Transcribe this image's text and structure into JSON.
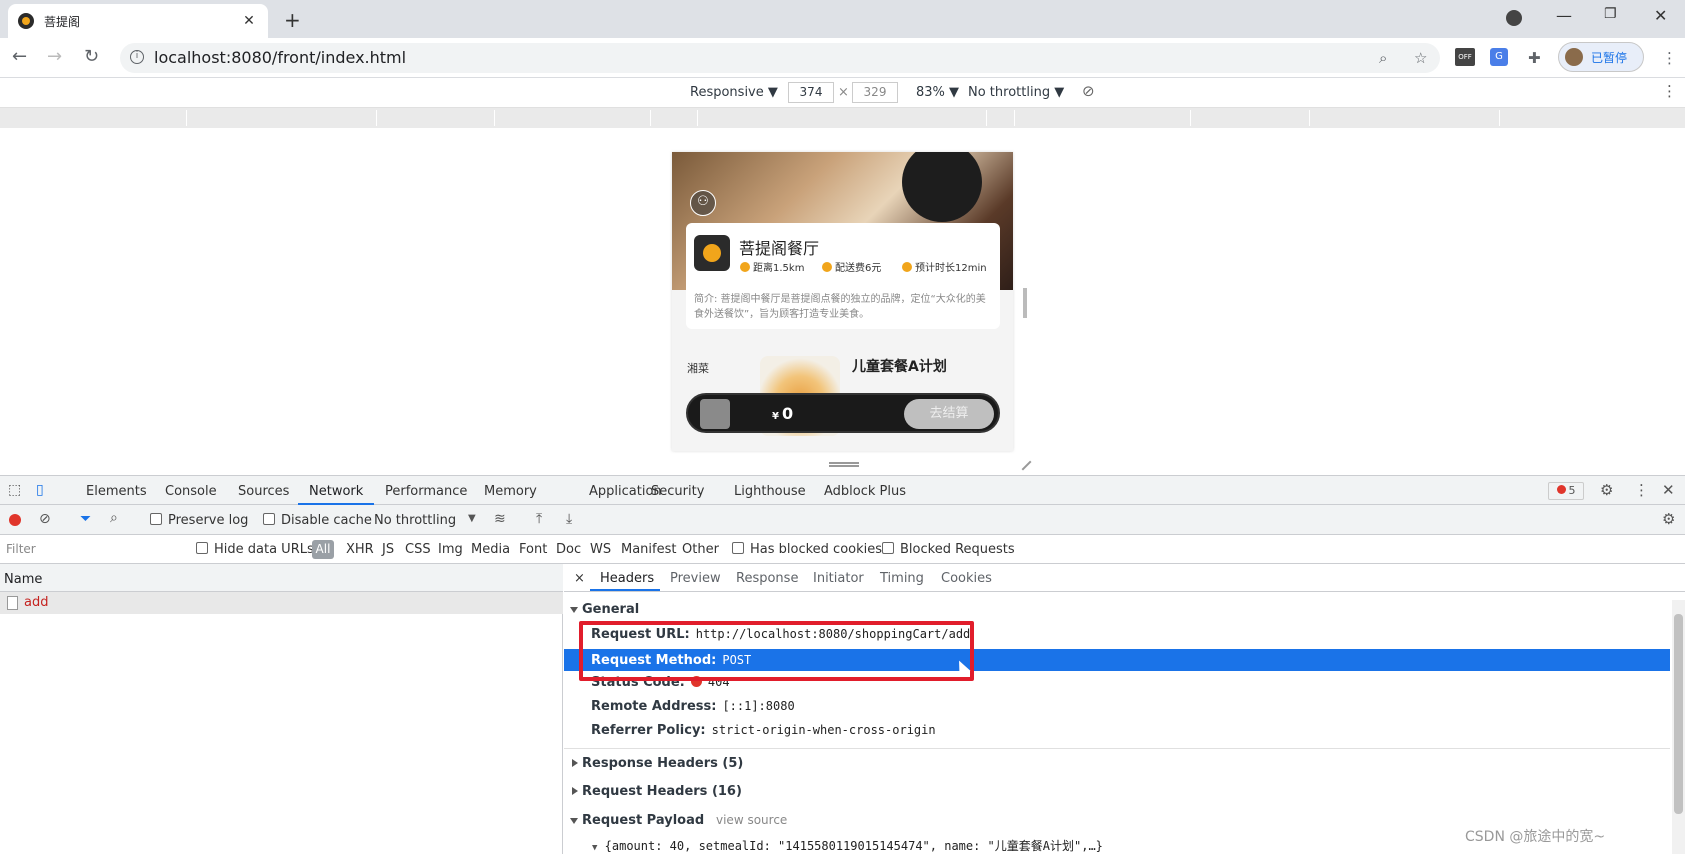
{
  "browser": {
    "tab_title": "菩提阁",
    "tab_close": "✕",
    "new_tab": "+",
    "url": "localhost:8080/front/index.html",
    "profile_label": "已暂停",
    "ext_off_label": "OFF",
    "ext_translate_label": "G"
  },
  "device_toolbar": {
    "device": "Responsive ▼",
    "width": "374",
    "times": "×",
    "height": "329",
    "zoom": "83% ▼",
    "throttling": "No throttling ▼"
  },
  "phone": {
    "restaurant_name": "菩提阁餐厅",
    "distance": "距离1.5km",
    "delivery_fee": "配送费6元",
    "eta": "预计时长12min",
    "intro": "简介: 菩提阁中餐厅是菩提阁点餐的独立的品牌，定位“大众化的美食外送餐饮”，旨为顾客打造专业美食。",
    "category": "湘菜",
    "dish_name": "儿童套餐A计划",
    "currency": "¥",
    "total": "0",
    "checkout": "去结算"
  },
  "devtools": {
    "tabs": [
      "Elements",
      "Console",
      "Sources",
      "Network",
      "Performance",
      "Memory",
      "Application",
      "Security",
      "Lighthouse",
      "Adblock Plus"
    ],
    "error_count": "5",
    "network_toolbar": {
      "preserve_log": "Preserve log",
      "disable_cache": "Disable cache",
      "throttling": "No throttling"
    },
    "filter_bar": {
      "placeholder": "Filter",
      "hide_data_urls": "Hide data URLs",
      "types": [
        "All",
        "XHR",
        "JS",
        "CSS",
        "Img",
        "Media",
        "Font",
        "Doc",
        "WS",
        "Manifest",
        "Other"
      ],
      "has_blocked_cookies": "Has blocked cookies",
      "blocked_requests": "Blocked Requests"
    },
    "list": {
      "header": "Name",
      "rows": [
        "add"
      ]
    },
    "detail_tabs": [
      "Headers",
      "Preview",
      "Response",
      "Initiator",
      "Timing",
      "Cookies"
    ],
    "detail_close": "×",
    "general": {
      "title": "General",
      "request_url_label": "Request URL:",
      "request_url": "http://localhost:8080/shoppingCart/add",
      "request_method_label": "Request Method:",
      "request_method": "POST",
      "status_code_label": "Status Code:",
      "status_code": "404",
      "remote_address_label": "Remote Address:",
      "remote_address": "[::1]:8080",
      "referrer_policy_label": "Referrer Policy:",
      "referrer_policy": "strict-origin-when-cross-origin"
    },
    "response_headers": "Response Headers (5)",
    "request_headers": "Request Headers (16)",
    "request_payload": "Request Payload",
    "view_source": "view source",
    "payload_preview": "{amount: 40, setmealId: \"1415580119015145474\", name: \"儿童套餐A计划\",…}"
  },
  "watermark": "CSDN @旅途中的宽~",
  "colors": {
    "accent": "#1a73e8",
    "highlight_box": "#e11d2b",
    "error": "#e0352b"
  }
}
